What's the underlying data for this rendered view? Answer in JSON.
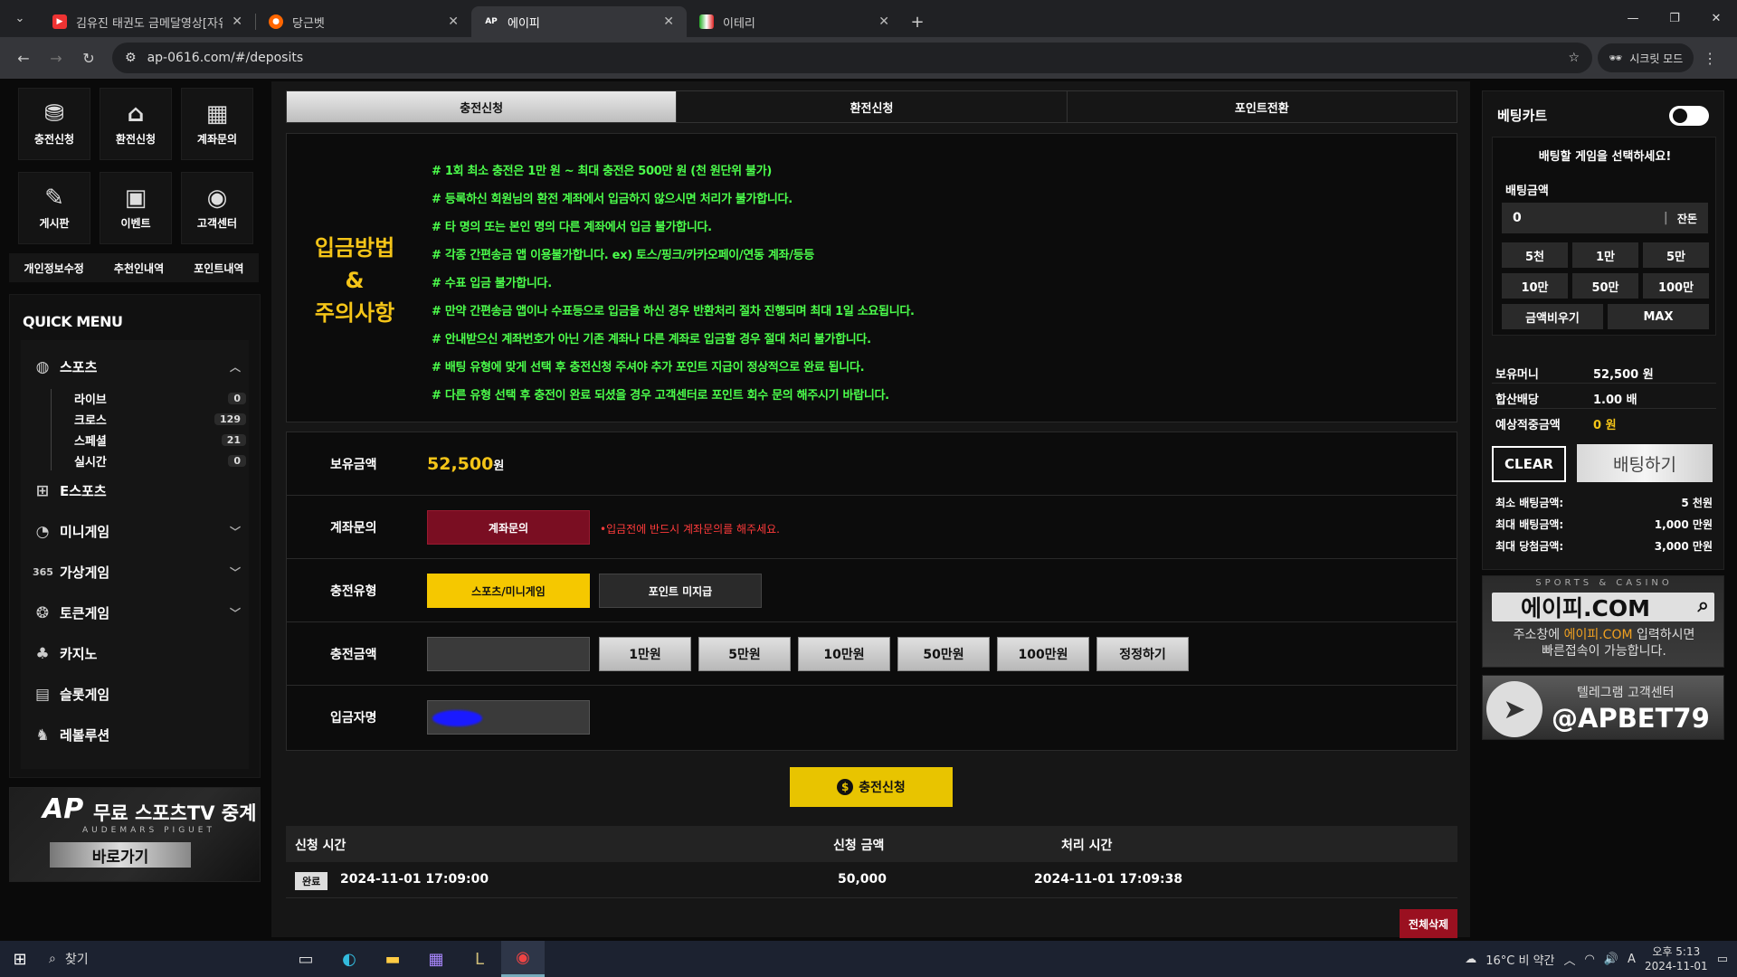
{
  "browser": {
    "tabs": [
      {
        "title": "김유진 태권도 금메달영상[자유",
        "active": false,
        "fav": "yt"
      },
      {
        "title": "당근벳",
        "active": false,
        "fav": "carrot"
      },
      {
        "title": "에이피",
        "active": true,
        "fav": "AP"
      },
      {
        "title": "이테리",
        "active": false,
        "fav": "flag"
      }
    ],
    "url": "ap-0616.com/#/deposits",
    "incognito": "시크릿 모드"
  },
  "left": {
    "grid": [
      {
        "label": "충전신청",
        "icon": "coins-icon",
        "glyph": "⛃"
      },
      {
        "label": "환전신청",
        "icon": "bank-icon",
        "glyph": "🏛"
      },
      {
        "label": "계좌문의",
        "icon": "calculator-icon",
        "glyph": "▦"
      },
      {
        "label": "게시판",
        "icon": "board-icon",
        "glyph": "✎"
      },
      {
        "label": "이벤트",
        "icon": "event-icon",
        "glyph": "▣"
      },
      {
        "label": "고객센터",
        "icon": "support-icon",
        "glyph": "?"
      }
    ],
    "sublinks": [
      "개인정보수정",
      "추천인내역",
      "포인트내역"
    ],
    "quick_menu": {
      "title": "QUICK MENU",
      "sports": "스포츠",
      "sub": [
        {
          "label": "라이브",
          "count": "0"
        },
        {
          "label": "크로스",
          "count": "129"
        },
        {
          "label": "스페셜",
          "count": "21"
        },
        {
          "label": "실시간",
          "count": "0"
        }
      ],
      "items": [
        "E스포츠",
        "미니게임",
        "가상게임",
        "토큰게임",
        "카지노",
        "슬롯게임",
        "레볼루션"
      ]
    },
    "banner": {
      "logo": "AP",
      "title": "무료 스포츠TV 중계",
      "sub": "AUDEMARS PIGUET",
      "button": "바로가기"
    }
  },
  "main": {
    "tabs": [
      "충전신청",
      "환전신청",
      "포인트전환"
    ],
    "notice_title": [
      "입금방법",
      "&",
      "주의사항"
    ],
    "notice_lines": [
      "# 1회 최소 충전은 1만 원 ~ 최대 충전은 500만 원 (천 원단위 불가)",
      "# 등록하신 회원님의 환전 계좌에서 입금하지 않으시면 처리가 불가합니다.",
      "# 타 명의 또는 본인 명의 다른 계좌에서 입금 불가합니다.",
      "# 각종 간편송금 앱 이용불가합니다. ex) 토스/핑크/카카오페이/연동 계좌/등등",
      "# 수표 입금 불가합니다.",
      "# 만약 간편송금 앱이나 수표등으로 입금을 하신 경우 반환처리 절차 진행되며 최대 1일 소요됩니다.",
      "# 안내받으신 계좌번호가 아닌 기존 계좌나 다른 계좌로 입금할 경우 절대 처리 불가합니다.",
      "# 배팅 유형에 맞게 선택 후 충전신청 주셔야 추가 포인트 지급이 정상적으로 완료 됩니다.",
      "# 다른 유형 선택 후 충전이 완료 되셨을 경우 고객센터로 포인트 회수 문의 해주시기 바랍니다."
    ],
    "form": {
      "balance_label": "보유금액",
      "balance": "52,500",
      "won": "원",
      "account_label": "계좌문의",
      "account_button": "계좌문의",
      "account_warn": "•입금전에 반드시 계좌문의를 해주세요.",
      "type_label": "충전유형",
      "type_a": "스포츠/미니게임",
      "type_b": "포인트 미지급",
      "amount_label": "충전금액",
      "amounts": [
        "1만원",
        "5만원",
        "10만원",
        "50만원",
        "100만원",
        "정정하기"
      ],
      "name_label": "입금자명"
    },
    "submit": "충전신청",
    "history": {
      "headers": [
        "신청 시간",
        "신청 금액",
        "처리 시간"
      ],
      "rows": [
        {
          "status": "완료",
          "time": "2024-11-01 17:09:00",
          "amount": "50,000",
          "done": "2024-11-01 17:09:38"
        }
      ]
    },
    "delete_all": "전체삭제"
  },
  "betcart": {
    "title": "베팅카트",
    "select_prompt": "배팅할 게임을 선택하세요!",
    "amount_label": "배팅금액",
    "amount_value": "0",
    "rest": "잔돈",
    "chips": [
      "5천",
      "1만",
      "5만",
      "10만",
      "50만",
      "100만",
      "금액비우기",
      "MAX"
    ],
    "stats": [
      {
        "label": "보유머니",
        "value": "52,500 원"
      },
      {
        "label": "합산배당",
        "value": "1.00 배"
      },
      {
        "label": "예상적중금액",
        "value": "0 원"
      }
    ],
    "clear": "CLEAR",
    "bet": "배팅하기",
    "limits": [
      {
        "label": "최소 배팅금액:",
        "value": "5 천원"
      },
      {
        "label": "최대 배팅금액:",
        "value": "1,000 만원"
      },
      {
        "label": "최대 당첨금액:",
        "value": "3,000 만원"
      }
    ]
  },
  "ads": {
    "casino_tag": "SPORTS & CASINO",
    "domain": "에이피.COM",
    "desc_pre": "주소창에 ",
    "desc_hl": "에이피.COM",
    "desc_post": " 입력하시면",
    "desc2": "빠른접속이 가능합니다.",
    "tg_title": "텔레그램 고객센터",
    "tg_handle": "@APBET79"
  },
  "taskbar": {
    "search": "찾기",
    "weather": "16°C  비 약간",
    "time": "오후 5:13",
    "date": "2024-11-01"
  }
}
